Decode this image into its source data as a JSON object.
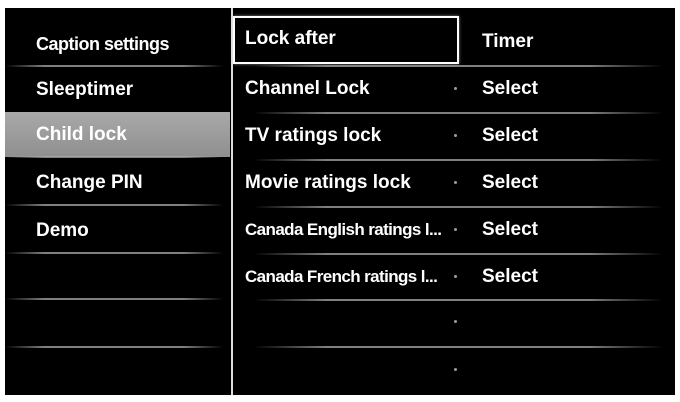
{
  "left_menu": {
    "items": [
      {
        "label": "Caption settings"
      },
      {
        "label": "Sleeptimer"
      },
      {
        "label": "Child lock"
      },
      {
        "label": "Change PIN"
      },
      {
        "label": "Demo"
      }
    ],
    "selected": "Child lock"
  },
  "middle_menu": {
    "items": [
      {
        "label": "Lock after"
      },
      {
        "label": "Channel Lock"
      },
      {
        "label": "TV ratings lock"
      },
      {
        "label": "Movie ratings lock"
      },
      {
        "label": "Canada English ratings l..."
      },
      {
        "label": "Canada French ratings l..."
      }
    ],
    "focused": "Lock after"
  },
  "right_values": {
    "items": [
      {
        "label": "Timer"
      },
      {
        "label": "Select"
      },
      {
        "label": "Select"
      },
      {
        "label": "Select"
      },
      {
        "label": "Select"
      },
      {
        "label": "Select"
      }
    ]
  },
  "colors": {
    "background": "#000000",
    "text": "#ffffff",
    "selected_highlight": "#9e9e9e",
    "focus_border": "#ffffff"
  }
}
